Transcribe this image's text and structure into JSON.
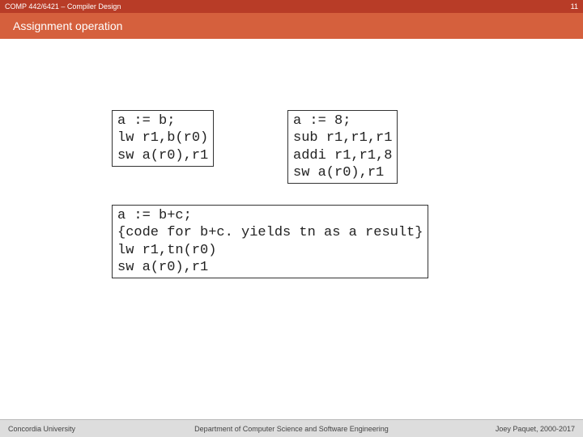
{
  "header": {
    "course": "COMP 442/6421 – Compiler Design",
    "page_number": "11"
  },
  "title": "Assignment operation",
  "code_blocks": {
    "block1": "a := b;\nlw r1,b(r0)\nsw a(r0),r1",
    "block2": "a := 8;\nsub r1,r1,r1\naddi r1,r1,8\nsw a(r0),r1",
    "block3": "a := b+c;\n{code for b+c. yields tn as a result}\nlw r1,tn(r0)\nsw a(r0),r1"
  },
  "footer": {
    "left": "Concordia University",
    "center": "Department of Computer Science and Software Engineering",
    "right": "Joey Paquet, 2000-2017"
  }
}
